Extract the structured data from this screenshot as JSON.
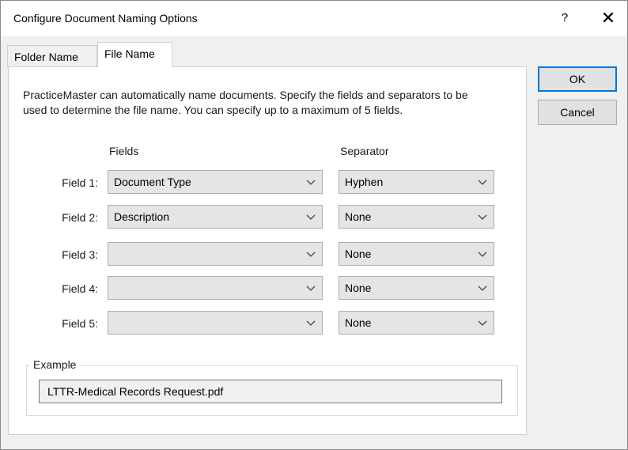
{
  "window": {
    "title": "Configure Document Naming Options",
    "help_label": "?",
    "close_label": "✕"
  },
  "tabs": [
    {
      "label": "Folder Name",
      "selected": false
    },
    {
      "label": "File Name",
      "selected": true
    }
  ],
  "description": "PracticeMaster can automatically name documents.  Specify the fields and separators to be used to determine the file name.  You can specify up to a maximum of 5 fields.",
  "columns": {
    "fields": "Fields",
    "separator": "Separator"
  },
  "rows": [
    {
      "label": "Field 1:",
      "field": "Document Type",
      "separator": "Hyphen"
    },
    {
      "label": "Field 2:",
      "field": "Description",
      "separator": "None"
    },
    {
      "label": "Field 3:",
      "field": "",
      "separator": "None"
    },
    {
      "label": "Field 4:",
      "field": "",
      "separator": "None"
    },
    {
      "label": "Field 5:",
      "field": "",
      "separator": "None"
    }
  ],
  "example": {
    "label": "Example",
    "value": "LTTR-Medical Records Request.pdf"
  },
  "buttons": {
    "ok": "OK",
    "cancel": "Cancel"
  },
  "colors": {
    "accent": "#0078d7",
    "dialog_bg": "#f0f0f0",
    "panel_bg": "#ffffff"
  },
  "icons": {
    "dropdown": "chevron-down-icon",
    "close": "close-icon",
    "help": "help-icon"
  }
}
